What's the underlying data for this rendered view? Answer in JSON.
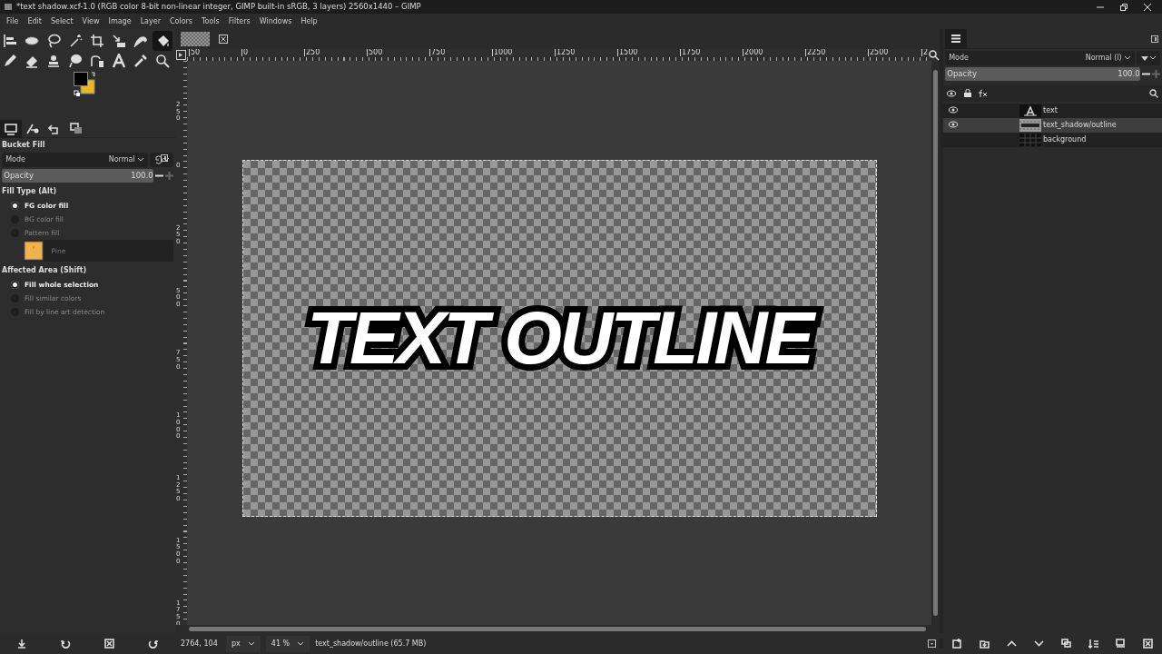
{
  "window": {
    "title": "*text shadow.xcf-1.0 (RGB color 8-bit non-linear integer, GIMP built-in sRGB, 3 layers) 2560x1440 – GIMP"
  },
  "menu": [
    "File",
    "Edit",
    "Select",
    "View",
    "Image",
    "Layer",
    "Colors",
    "Tools",
    "Filters",
    "Windows",
    "Help"
  ],
  "toolbox": {
    "tools": [
      {
        "kind": "align",
        "selected": false
      },
      {
        "kind": "ellipse",
        "selected": false
      },
      {
        "kind": "lasso",
        "selected": false
      },
      {
        "kind": "wand",
        "selected": false
      },
      {
        "kind": "crop",
        "selected": false
      },
      {
        "kind": "transform",
        "selected": false
      },
      {
        "kind": "warp",
        "selected": false
      },
      {
        "kind": "bucket",
        "selected": true
      },
      {
        "kind": "pencil",
        "selected": false
      },
      {
        "kind": "eraser",
        "selected": false
      },
      {
        "kind": "stamp",
        "selected": false
      },
      {
        "kind": "smudge",
        "selected": false
      },
      {
        "kind": "paths",
        "selected": false
      },
      {
        "kind": "text",
        "selected": false
      },
      {
        "kind": "picker",
        "selected": false
      },
      {
        "kind": "zoom",
        "selected": false
      }
    ]
  },
  "tool_options": {
    "tabs": [
      {
        "kind": "options",
        "selected": true
      },
      {
        "kind": "device",
        "selected": false
      },
      {
        "kind": "undo",
        "selected": false
      },
      {
        "kind": "images",
        "selected": false
      }
    ],
    "title": "Bucket Fill",
    "mode_label": "Mode",
    "mode_value": "Normal",
    "opacity": {
      "label": "Opacity",
      "value": "100.0",
      "level": 1.0
    },
    "fill_type": {
      "heading": "Fill Type  (Alt)",
      "options": [
        {
          "label": "FG color fill",
          "selected": true
        },
        {
          "label": "BG color fill",
          "selected": false
        },
        {
          "label": "Pattern fill",
          "selected": false
        }
      ]
    },
    "pattern": {
      "name": "Pine"
    },
    "affected_area": {
      "heading": "Affected Area  (Shift)",
      "options": [
        {
          "label": "Fill whole selection",
          "selected": true
        },
        {
          "label": "Fill similar colors",
          "selected": false
        },
        {
          "label": "Fill by line art detection",
          "selected": false
        }
      ]
    }
  },
  "rulers": {
    "horizontal": [
      "50",
      "0",
      "250",
      "500",
      "750",
      "1000",
      "1250",
      "1500",
      "1750",
      "2000",
      "2250",
      "2500",
      "2"
    ],
    "vertical": [
      "250",
      "0",
      "250",
      "500",
      "750",
      "1000",
      "1250",
      "1500",
      "1750"
    ]
  },
  "canvas": {
    "text": "TEXT OUTLINE"
  },
  "status_bar": {
    "coordinates": "2764, 104",
    "unit": "px",
    "zoom": "41 %",
    "message": "text_shadow/outline (65.7 MB)"
  },
  "layers_panel": {
    "mode_label": "Mode",
    "mode_value": "Normal (l)",
    "opacity": {
      "label": "Opacity",
      "value": "100.0",
      "level": 1.0
    },
    "layers": [
      {
        "name": "text",
        "kind": "text",
        "visible": true,
        "selected": false
      },
      {
        "name": "text_shadow/outline",
        "kind": "pattern",
        "visible": true,
        "selected": true
      },
      {
        "name": "background",
        "kind": "dark",
        "visible": false,
        "selected": false
      }
    ]
  }
}
